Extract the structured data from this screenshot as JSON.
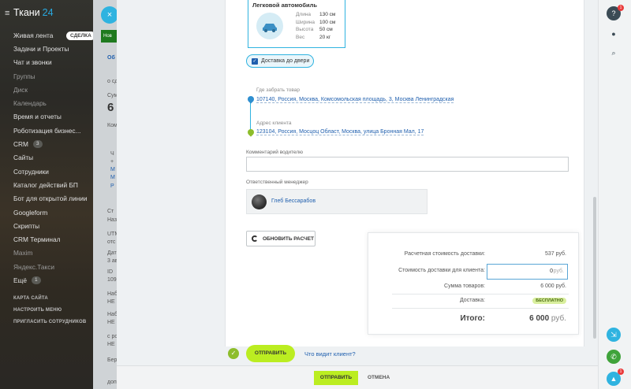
{
  "sidebar": {
    "logo_name": "Ткани",
    "logo_num": "24",
    "quick_button": "СДЕЛКА",
    "items": [
      {
        "label": "Живая лента"
      },
      {
        "label": "Задачи и Проекты"
      },
      {
        "label": "Чат и звонки"
      },
      {
        "label": "Группы"
      },
      {
        "label": "Диск"
      },
      {
        "label": "Календарь"
      },
      {
        "label": "Время и отчеты"
      },
      {
        "label": "Роботизация бизнес..."
      },
      {
        "label": "CRM",
        "badge": "3"
      },
      {
        "label": "Сайты"
      },
      {
        "label": "Сотрудники"
      },
      {
        "label": "Каталог действий БП"
      },
      {
        "label": "Бот для открытой линии"
      },
      {
        "label": "Googleform"
      },
      {
        "label": "Скрипты"
      },
      {
        "label": "CRM Терминал"
      },
      {
        "label": "Maxim"
      },
      {
        "label": "Яндекс.Такси"
      },
      {
        "label": "Ещё",
        "badge": "1"
      }
    ],
    "sys": [
      "КАРТА САЙТА",
      "НАСТРОИТЬ МЕНЮ",
      "ПРИГЛАСИТЬ СОТРУДНИКОВ"
    ]
  },
  "back": {
    "close": "×",
    "tag": "Нов",
    "snippets": [
      "Об",
      "о сд",
      "Сум",
      "6",
      "Комп",
      "Ч",
      "+",
      "М",
      "М",
      "Р",
      "Ст",
      "Наз",
      "UTM",
      "отс",
      "Дата",
      "3 ав",
      "ID",
      "109",
      "Наб",
      "НЕ 3",
      "Наб",
      "НЕ 3",
      "с рос",
      "НЕ 3",
      "Бер",
      "допо"
    ]
  },
  "vehicle": {
    "title": "Легковой автомобиль",
    "specs": [
      {
        "label": "Длина",
        "value": "130 см"
      },
      {
        "label": "Ширина",
        "value": "100 см"
      },
      {
        "label": "Высота",
        "value": "50 см"
      },
      {
        "label": "Вес",
        "value": "20 кг"
      }
    ]
  },
  "door_delivery": "Доставка до двери",
  "route": {
    "pickup_label": "Где забрать товар",
    "pickup_address": "107140, Россия, Москва, Комсомольская площадь, 3, Москва Ленинградская",
    "client_label": "Адрес клиента",
    "client_address": "123104, Россия, Мосцоц Област, Москва, улица Бронная Мал, 17"
  },
  "comment_label": "Комментарий водителю",
  "manager_label": "Ответственный менеджер",
  "manager_name": "Глеб Бессарабов",
  "recalc_label": "ОБНОВИТЬ РАСЧЕТ",
  "summary": {
    "calc_label": "Расчетная стоимость доставки:",
    "calc_value": "537 руб.",
    "client_label": "Стоимость доставки для клиента:",
    "client_value": "0",
    "client_currency": "руб.",
    "goods_label": "Сумма товаров:",
    "goods_value": "6 000 руб.",
    "delivery_label": "Доставка:",
    "delivery_value": "БЕСПЛАТНО",
    "total_label": "Итого:",
    "total_value": "6 000",
    "total_currency": "руб."
  },
  "send_label": "ОТПРАВИТЬ",
  "see_link": "Что видит клиент?",
  "footer": {
    "send": "ОТПРАВИТЬ",
    "cancel": "ОТМЕНА"
  },
  "rightbar": {
    "help_badge": "1",
    "chat_badge": "1"
  },
  "colors": {
    "accent": "#2fb3e0",
    "send": "#bbed21",
    "link": "#1f5fae",
    "arrow": "#ff6a00"
  }
}
